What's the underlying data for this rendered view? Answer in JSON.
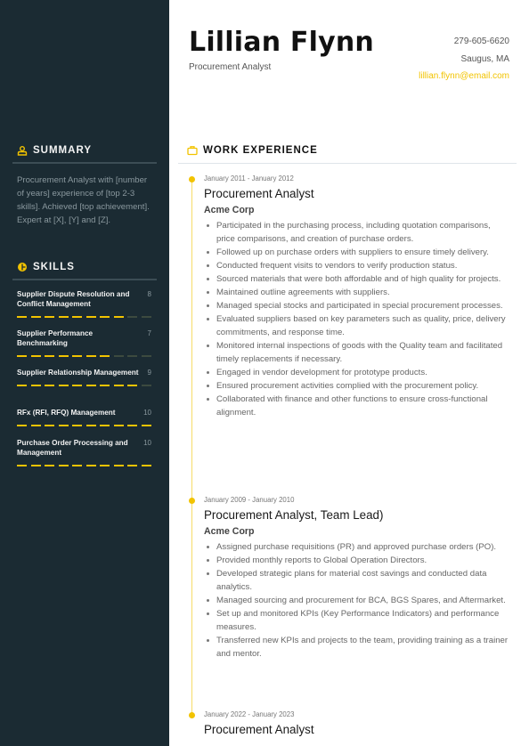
{
  "header": {
    "name": "Lillian Flynn",
    "role": "Procurement Analyst",
    "phone": "279-605-6620",
    "location": "Saugus, MA",
    "email": "lillian.flynn@email.com"
  },
  "colors": {
    "accent": "#f2c300",
    "sidebar_bg": "#1b2b33"
  },
  "summary": {
    "title": "SUMMARY",
    "icon": "user-icon",
    "text": "Procurement Analyst with [number of years] experience of [top 2-3 skills]. Achieved [top achievement]. Expert at [X], [Y] and [Z]."
  },
  "skills": {
    "title": "SKILLS",
    "icon": "pie-chart-icon",
    "max": 10,
    "items": [
      {
        "label": "Supplier Dispute Resolution and Conflict Management",
        "score": "8",
        "level": 8
      },
      {
        "label": "Supplier Performance Benchmarking",
        "score": "7",
        "level": 7
      },
      {
        "label": "Supplier Relationship Management",
        "score": "9",
        "level": 9
      },
      {
        "label": "RFx (RFI, RFQ) Management",
        "score": "10",
        "level": 10
      },
      {
        "label": "Purchase Order Processing and Management",
        "score": "10",
        "level": 10
      }
    ]
  },
  "work": {
    "title": "WORK EXPERIENCE",
    "icon": "briefcase-icon",
    "jobs": [
      {
        "dates": "January 2011 - January 2012",
        "title": "Procurement Analyst",
        "company": "Acme Corp",
        "bullets": [
          "Participated in the purchasing process, including quotation comparisons, price comparisons, and creation of purchase orders.",
          "Followed up on purchase orders with suppliers to ensure timely delivery.",
          "Conducted frequent visits to vendors to verify production status.",
          "Sourced materials that were both affordable and of high quality for projects.",
          "Maintained outline agreements with suppliers.",
          "Managed special stocks and participated in special procurement processes.",
          "Evaluated suppliers based on key parameters such as quality, price, delivery commitments, and response time.",
          "Monitored internal inspections of goods with the Quality team and facilitated timely replacements if necessary.",
          "Engaged in vendor development for prototype products.",
          "Ensured procurement activities complied with the procurement policy.",
          "Collaborated with finance and other functions to ensure cross-functional alignment."
        ]
      },
      {
        "dates": "January 2009 - January 2010",
        "title": "Procurement Analyst, Team Lead)",
        "company": "Acme Corp",
        "bullets": [
          "Assigned purchase requisitions (PR) and approved purchase orders (PO).",
          "Provided monthly reports to Global Operation Directors.",
          "Developed strategic plans for material cost savings and conducted data analytics.",
          "Managed sourcing and procurement for BCA, BGS Spares, and Aftermarket.",
          "Set up and monitored KPIs (Key Performance Indicators) and performance measures.",
          "Transferred new KPIs and projects to the team, providing training as a trainer and mentor."
        ]
      },
      {
        "dates": "January 2022 - January 2023",
        "title": "Procurement Analyst",
        "company": "",
        "bullets": []
      }
    ]
  }
}
